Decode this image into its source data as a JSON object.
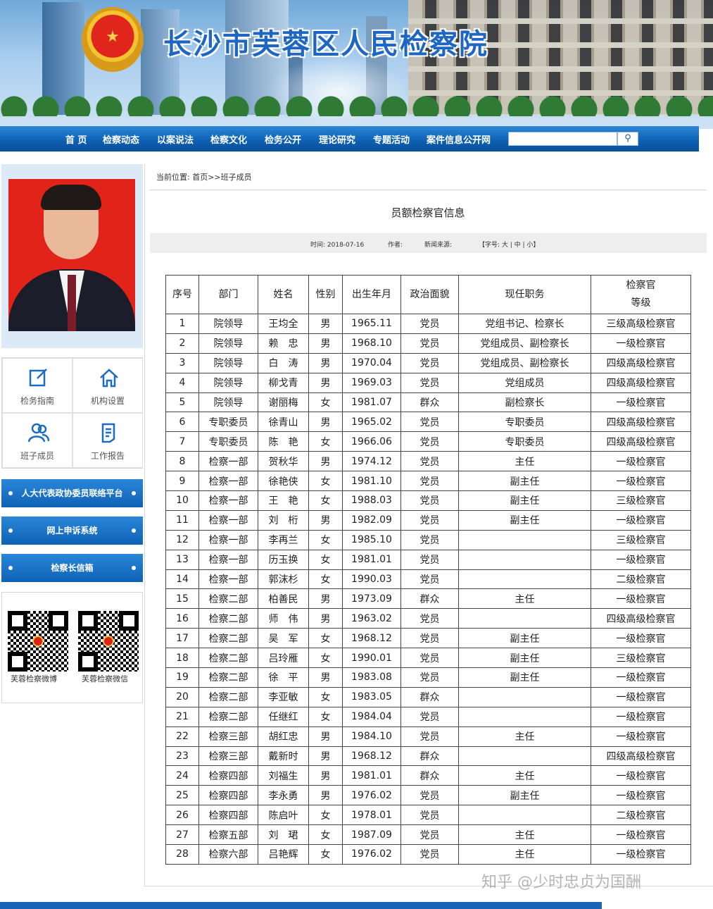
{
  "header": {
    "site_title": "长沙市芙蓉区人民检察院",
    "emblem_icon": "national-emblem-icon"
  },
  "nav": {
    "items": [
      "首 页",
      "检察动态",
      "以案说法",
      "检察文化",
      "检务公开",
      "理论研究",
      "专题活动",
      "案件信息公开网"
    ],
    "search_placeholder": "",
    "search_icon": "search-icon"
  },
  "sidebar": {
    "quick_links": [
      {
        "label": "检务指南",
        "icon": "edit-icon"
      },
      {
        "label": "机构设置",
        "icon": "home-icon"
      },
      {
        "label": "班子成员",
        "icon": "people-icon"
      },
      {
        "label": "工作报告",
        "icon": "document-icon"
      }
    ],
    "banners": [
      "人大代表政协委员联络平台",
      "网上申诉系统",
      "检察长信箱"
    ],
    "qr_codes": [
      {
        "label": "芙蓉检察微博"
      },
      {
        "label": "芙蓉检察微信"
      }
    ]
  },
  "breadcrumb": "当前位置:  首页>>班子成员",
  "article": {
    "title": "员额检察官信息",
    "meta": {
      "time": "时间:  2018-07-16",
      "author": "作者:",
      "source": "新闻来源:",
      "font_size": "【字号: 大 | 中 | 小】"
    }
  },
  "table": {
    "headers": [
      "序号",
      "部门",
      "姓名",
      "性别",
      "出生年月",
      "政治面貌",
      "现任职务",
      "检察官",
      "等级"
    ],
    "rows": [
      [
        "1",
        "院领导",
        "王均全",
        "男",
        "1965.11",
        "党员",
        "党组书记、检察长",
        "三级高级检察官"
      ],
      [
        "2",
        "院领导",
        "赖　忠",
        "男",
        "1968.10",
        "党员",
        "党组成员、副检察长",
        "一级检察官"
      ],
      [
        "3",
        "院领导",
        "白　涛",
        "男",
        "1970.04",
        "党员",
        "党组成员、副检察长",
        "四级高级检察官"
      ],
      [
        "4",
        "院领导",
        "柳戈青",
        "男",
        "1969.03",
        "党员",
        "党组成员",
        "四级高级检察官"
      ],
      [
        "5",
        "院领导",
        "谢丽梅",
        "女",
        "1981.07",
        "群众",
        "副检察长",
        "一级检察官"
      ],
      [
        "6",
        "专职委员",
        "徐青山",
        "男",
        "1965.02",
        "党员",
        "专职委员",
        "四级高级检察官"
      ],
      [
        "7",
        "专职委员",
        "陈　艳",
        "女",
        "1966.06",
        "党员",
        "专职委员",
        "四级高级检察官"
      ],
      [
        "8",
        "检察一部",
        "贺秋华",
        "男",
        "1974.12",
        "党员",
        "主任",
        "一级检察官"
      ],
      [
        "9",
        "检察一部",
        "徐艳侠",
        "女",
        "1981.10",
        "党员",
        "副主任",
        "一级检察官"
      ],
      [
        "10",
        "检察一部",
        "王　艳",
        "女",
        "1988.03",
        "党员",
        "副主任",
        "三级检察官"
      ],
      [
        "11",
        "检察一部",
        "刘　桁",
        "男",
        "1982.09",
        "党员",
        "副主任",
        "一级检察官"
      ],
      [
        "12",
        "检察一部",
        "李再兰",
        "女",
        "1985.10",
        "党员",
        "",
        "三级检察官"
      ],
      [
        "13",
        "检察一部",
        "历玉换",
        "女",
        "1981.01",
        "党员",
        "",
        "一级检察官"
      ],
      [
        "14",
        "检察一部",
        "郭沫杉",
        "女",
        "1990.03",
        "党员",
        "",
        "二级检察官"
      ],
      [
        "15",
        "检察二部",
        "柏善民",
        "男",
        "1973.09",
        "群众",
        "主任",
        "一级检察官"
      ],
      [
        "16",
        "检察二部",
        "师　伟",
        "男",
        "1963.02",
        "党员",
        "",
        "四级高级检察官"
      ],
      [
        "17",
        "检察二部",
        "吴　军",
        "女",
        "1968.12",
        "党员",
        "副主任",
        "一级检察官"
      ],
      [
        "18",
        "检察二部",
        "吕玲雁",
        "女",
        "1990.01",
        "党员",
        "副主任",
        "三级检察官"
      ],
      [
        "19",
        "检察二部",
        "徐　平",
        "男",
        "1983.08",
        "党员",
        "副主任",
        "一级检察官"
      ],
      [
        "20",
        "检察二部",
        "李亚敏",
        "女",
        "1983.05",
        "群众",
        "",
        "一级检察官"
      ],
      [
        "21",
        "检察二部",
        "任继红",
        "女",
        "1984.04",
        "党员",
        "",
        "一级检察官"
      ],
      [
        "22",
        "检察三部",
        "胡红忠",
        "男",
        "1984.10",
        "党员",
        "主任",
        "一级检察官"
      ],
      [
        "23",
        "检察三部",
        "戴新时",
        "男",
        "1968.12",
        "群众",
        "",
        "四级高级检察官"
      ],
      [
        "24",
        "检察四部",
        "刘福生",
        "男",
        "1981.01",
        "群众",
        "主任",
        "一级检察官"
      ],
      [
        "25",
        "检察四部",
        "李永勇",
        "男",
        "1976.02",
        "党员",
        "副主任",
        "一级检察官"
      ],
      [
        "26",
        "检察四部",
        "陈启叶",
        "女",
        "1978.01",
        "党员",
        "",
        "二级检察官"
      ],
      [
        "27",
        "检察五部",
        "刘　珺",
        "女",
        "1987.09",
        "党员",
        "主任",
        "一级检察官"
      ],
      [
        "28",
        "检察六部",
        "吕艳辉",
        "女",
        "1976.02",
        "党员",
        "主任",
        "一级检察官"
      ]
    ]
  },
  "watermark": "知乎 @少时忠贞为国酬",
  "colors": {
    "brand_blue": "#0d5fb1",
    "title_blue": "#1e66c3",
    "photo_bg": "#e2231a"
  }
}
